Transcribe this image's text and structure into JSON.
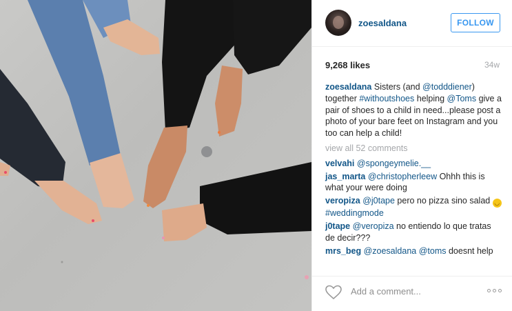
{
  "post": {
    "username": "zoesaldana",
    "follow_label": "FOLLOW",
    "likes": "9,268 likes",
    "age": "34w"
  },
  "caption": {
    "user": "zoesaldana",
    "t1": " Sisters (and ",
    "m1": "@todddiener",
    "t2": ") together ",
    "h1": "#withoutshoes",
    "t3": " helping ",
    "m2": "@Toms",
    "t4": " give a pair of shoes to a child in need...please post a photo of your bare feet on Instagram and you too can help a child!"
  },
  "view_all": "view all 52 comments",
  "comments": [
    {
      "user": "velvahi",
      "parts": [
        {
          "t": " "
        },
        {
          "l": "@spongeymelie.__"
        }
      ]
    },
    {
      "user": "jas_marta",
      "parts": [
        {
          "t": " "
        },
        {
          "l": "@christopherleew"
        },
        {
          "t": " Ohhh this is what your were doing"
        }
      ]
    },
    {
      "user": "veropiza",
      "parts": [
        {
          "t": " "
        },
        {
          "l": "@j0tape"
        },
        {
          "t": " pero no pizza sino salad "
        },
        {
          "e": "face-with-tears-of-joy"
        },
        {
          "l": "#weddingmode"
        }
      ]
    },
    {
      "user": "j0tape",
      "parts": [
        {
          "t": " "
        },
        {
          "l": "@veropiza"
        },
        {
          "t": " no entiendo lo que tratas de decir???"
        }
      ]
    },
    {
      "user": "mrs_beg",
      "parts": [
        {
          "t": " "
        },
        {
          "l": "@zoesaldana"
        },
        {
          "t": " "
        },
        {
          "l": "@toms"
        },
        {
          "t": " doesnt help"
        }
      ]
    }
  ],
  "footer": {
    "add_comment_placeholder": "Add a comment..."
  },
  "colors": {
    "link": "#125688",
    "follow": "#3897f0",
    "muted": "#a5a7aa"
  }
}
